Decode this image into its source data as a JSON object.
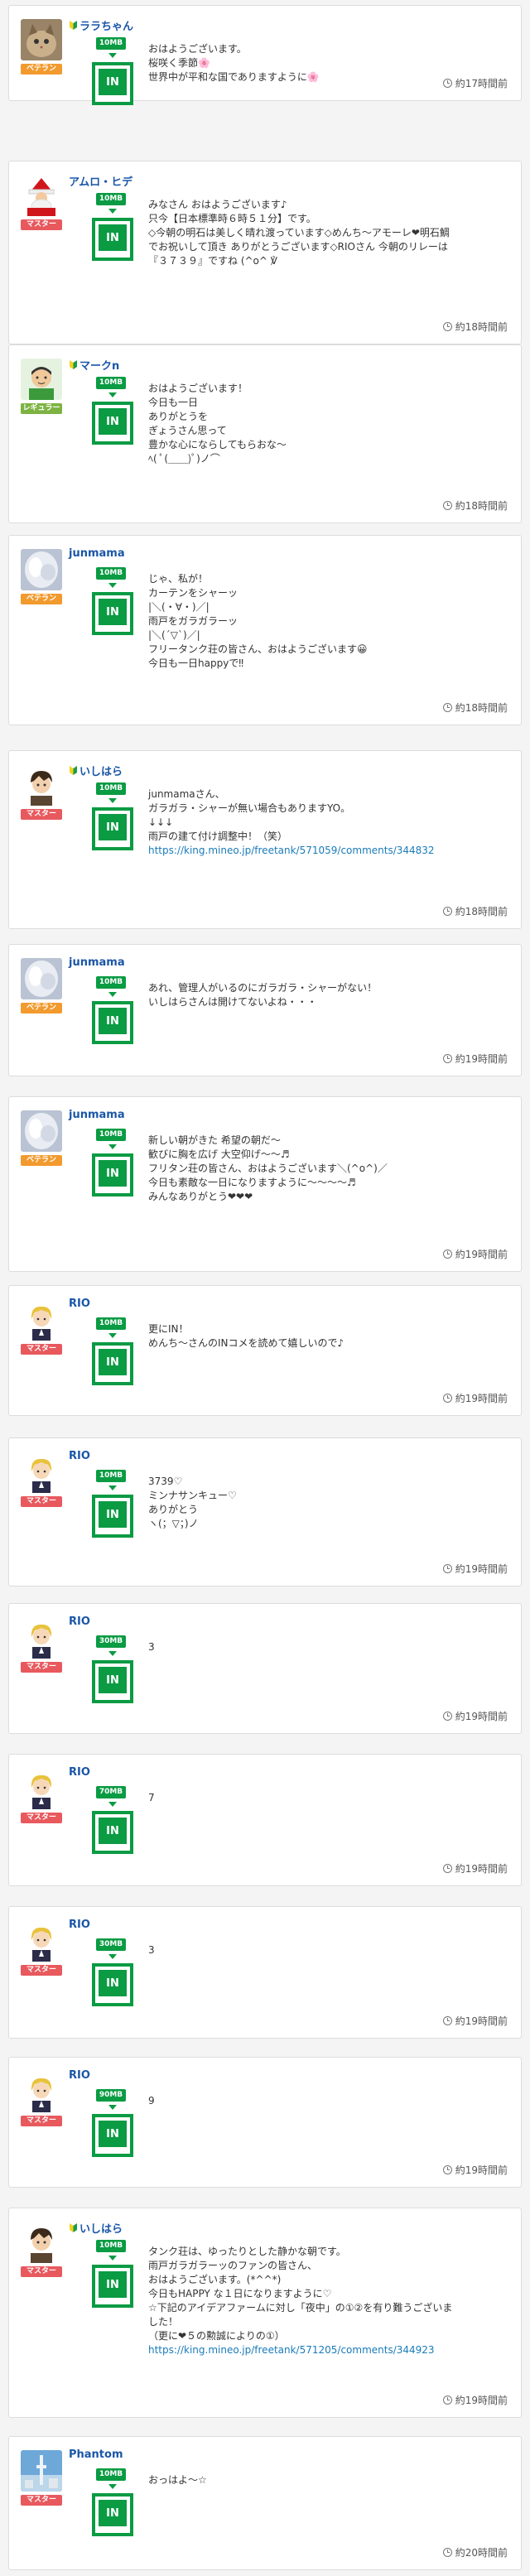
{
  "posts": [
    {
      "user": "ララちゃん",
      "rank": "ベテラン",
      "rank_color": "orange",
      "badge": true,
      "avatar": "cat",
      "mb": "10MB",
      "in": "IN",
      "lines": [
        "おはようございます。",
        "桜咲く季節🌸",
        "世界中が平和な国でありますように🌸"
      ],
      "link": "",
      "time": "約17時間前"
    },
    {
      "user": "アムロ・ヒデ",
      "rank": "マスター",
      "rank_color": "red",
      "badge": false,
      "avatar": "santa",
      "mb": "10MB",
      "in": "IN",
      "lines": [
        "みなさん おはようございます♪",
        "只今【日本標準時６時５１分】です。",
        "◇今朝の明石は美しく晴れ渡っています◇めんち〜アモーレ❤明石鯛",
        "でお祝いして頂き ありがとうございます◇RIOさん 今朝のリレーは",
        "『３７３９』ですね (^o^ ℣"
      ],
      "link": "",
      "time": "約18時間前"
    },
    {
      "user": "マークn",
      "rank": "レギュラー",
      "rank_color": "green",
      "badge": true,
      "avatar": "man",
      "mb": "10MB",
      "in": "IN",
      "lines": [
        "おはようございます！",
        "今日も一日",
        "ありがとうを",
        "ぎょうさん思って",
        "豊かな心にならしてもらおな〜",
        "ﾍ( ﾟ(＿＿)ﾟ)ノ⌒"
      ],
      "link": "",
      "time": "約18時間前"
    },
    {
      "user": "junmama",
      "rank": "ベテラン",
      "rank_color": "orange",
      "badge": false,
      "avatar": "angel",
      "mb": "10MB",
      "in": "IN",
      "lines": [
        "じゃ、私が！",
        "カーテンをシャーッ",
        "|＼(・∀・)／|",
        "雨戸をガラガラーッ",
        "|＼(´▽`)／|",
        "フリータンク荘の皆さん、おはようございます😀",
        "今日も一日happyで‼"
      ],
      "link": "",
      "time": "約18時間前"
    },
    {
      "user": "いしはら",
      "rank": "マスター",
      "rank_color": "red",
      "badge": true,
      "avatar": "boy",
      "mb": "10MB",
      "in": "IN",
      "lines": [
        "junmamaさん、",
        "ガラガラ・シャーが無い場合もありますYO。",
        "↓↓↓",
        "雨戸の建て付け調整中！（笑）"
      ],
      "link": "https://king.mineo.jp/freetank/571059/comments/344832",
      "time": "約18時間前"
    },
    {
      "user": "junmama",
      "rank": "ベテラン",
      "rank_color": "orange",
      "badge": false,
      "avatar": "angel",
      "mb": "10MB",
      "in": "IN",
      "lines": [
        "あれ、管理人がいるのにガラガラ・シャーがない！",
        "いしはらさんは開けてないよね・・・"
      ],
      "link": "",
      "time": "約19時間前"
    },
    {
      "user": "junmama",
      "rank": "ベテラン",
      "rank_color": "orange",
      "badge": false,
      "avatar": "angel",
      "mb": "10MB",
      "in": "IN",
      "lines": [
        "新しい朝がきた 希望の朝だ〜",
        "歓びに胸を広げ 大空仰げ〜〜♬",
        "フリタン荘の皆さん、おはようございます＼(^o^)／",
        "今日も素敵な一日になりますように〜〜〜〜♬",
        "みんなありがとう❤❤❤"
      ],
      "link": "",
      "time": "約19時間前"
    },
    {
      "user": "RIO",
      "rank": "マスター",
      "rank_color": "red",
      "badge": false,
      "avatar": "blonde",
      "mb": "10MB",
      "in": "IN",
      "lines": [
        "更にIN！",
        "めんち〜さんのINコメを読めて嬉しいので♪"
      ],
      "link": "",
      "time": "約19時間前"
    },
    {
      "user": "RIO",
      "rank": "マスター",
      "rank_color": "red",
      "badge": false,
      "avatar": "blonde",
      "mb": "10MB",
      "in": "IN",
      "lines": [
        "3739♡",
        "ミンナサンキュー♡",
        "ありがとう",
        "ヽ(；▽；)ノ"
      ],
      "link": "",
      "time": "約19時間前"
    },
    {
      "user": "RIO",
      "rank": "マスター",
      "rank_color": "red",
      "badge": false,
      "avatar": "blonde",
      "mb": "30MB",
      "in": "IN",
      "lines": [
        "3"
      ],
      "link": "",
      "time": "約19時間前"
    },
    {
      "user": "RIO",
      "rank": "マスター",
      "rank_color": "red",
      "badge": false,
      "avatar": "blonde",
      "mb": "70MB",
      "in": "IN",
      "lines": [
        "7"
      ],
      "link": "",
      "time": "約19時間前"
    },
    {
      "user": "RIO",
      "rank": "マスター",
      "rank_color": "red",
      "badge": false,
      "avatar": "blonde",
      "mb": "30MB",
      "in": "IN",
      "lines": [
        "3"
      ],
      "link": "",
      "time": "約19時間前"
    },
    {
      "user": "RIO",
      "rank": "マスター",
      "rank_color": "red",
      "badge": false,
      "avatar": "blonde",
      "mb": "90MB",
      "in": "IN",
      "lines": [
        "9"
      ],
      "link": "",
      "time": "約19時間前"
    },
    {
      "user": "いしはら",
      "rank": "マスター",
      "rank_color": "red",
      "badge": true,
      "avatar": "boy",
      "mb": "10MB",
      "in": "IN",
      "lines": [
        "タンク荘は、ゆったりとした静かな朝です。",
        "雨戸ガラガラーッのファンの皆さん、",
        "おはようございます。(*^^*)",
        "今日もHAPPY な１日になりますように♡",
        "☆下記のアイデアファームに対し「夜中」の①②を有り難うございま",
        "した！",
        "（更に❤５の勲誠によりの①）"
      ],
      "link": "https://king.mineo.jp/freetank/571205/comments/344923",
      "time": "約19時間前"
    },
    {
      "user": "Phantom",
      "rank": "マスター",
      "rank_color": "red",
      "badge": false,
      "avatar": "tower",
      "mb": "10MB",
      "in": "IN",
      "lines": [
        "おっはよ〜☆"
      ],
      "link": "",
      "time": "約20時間前"
    }
  ]
}
